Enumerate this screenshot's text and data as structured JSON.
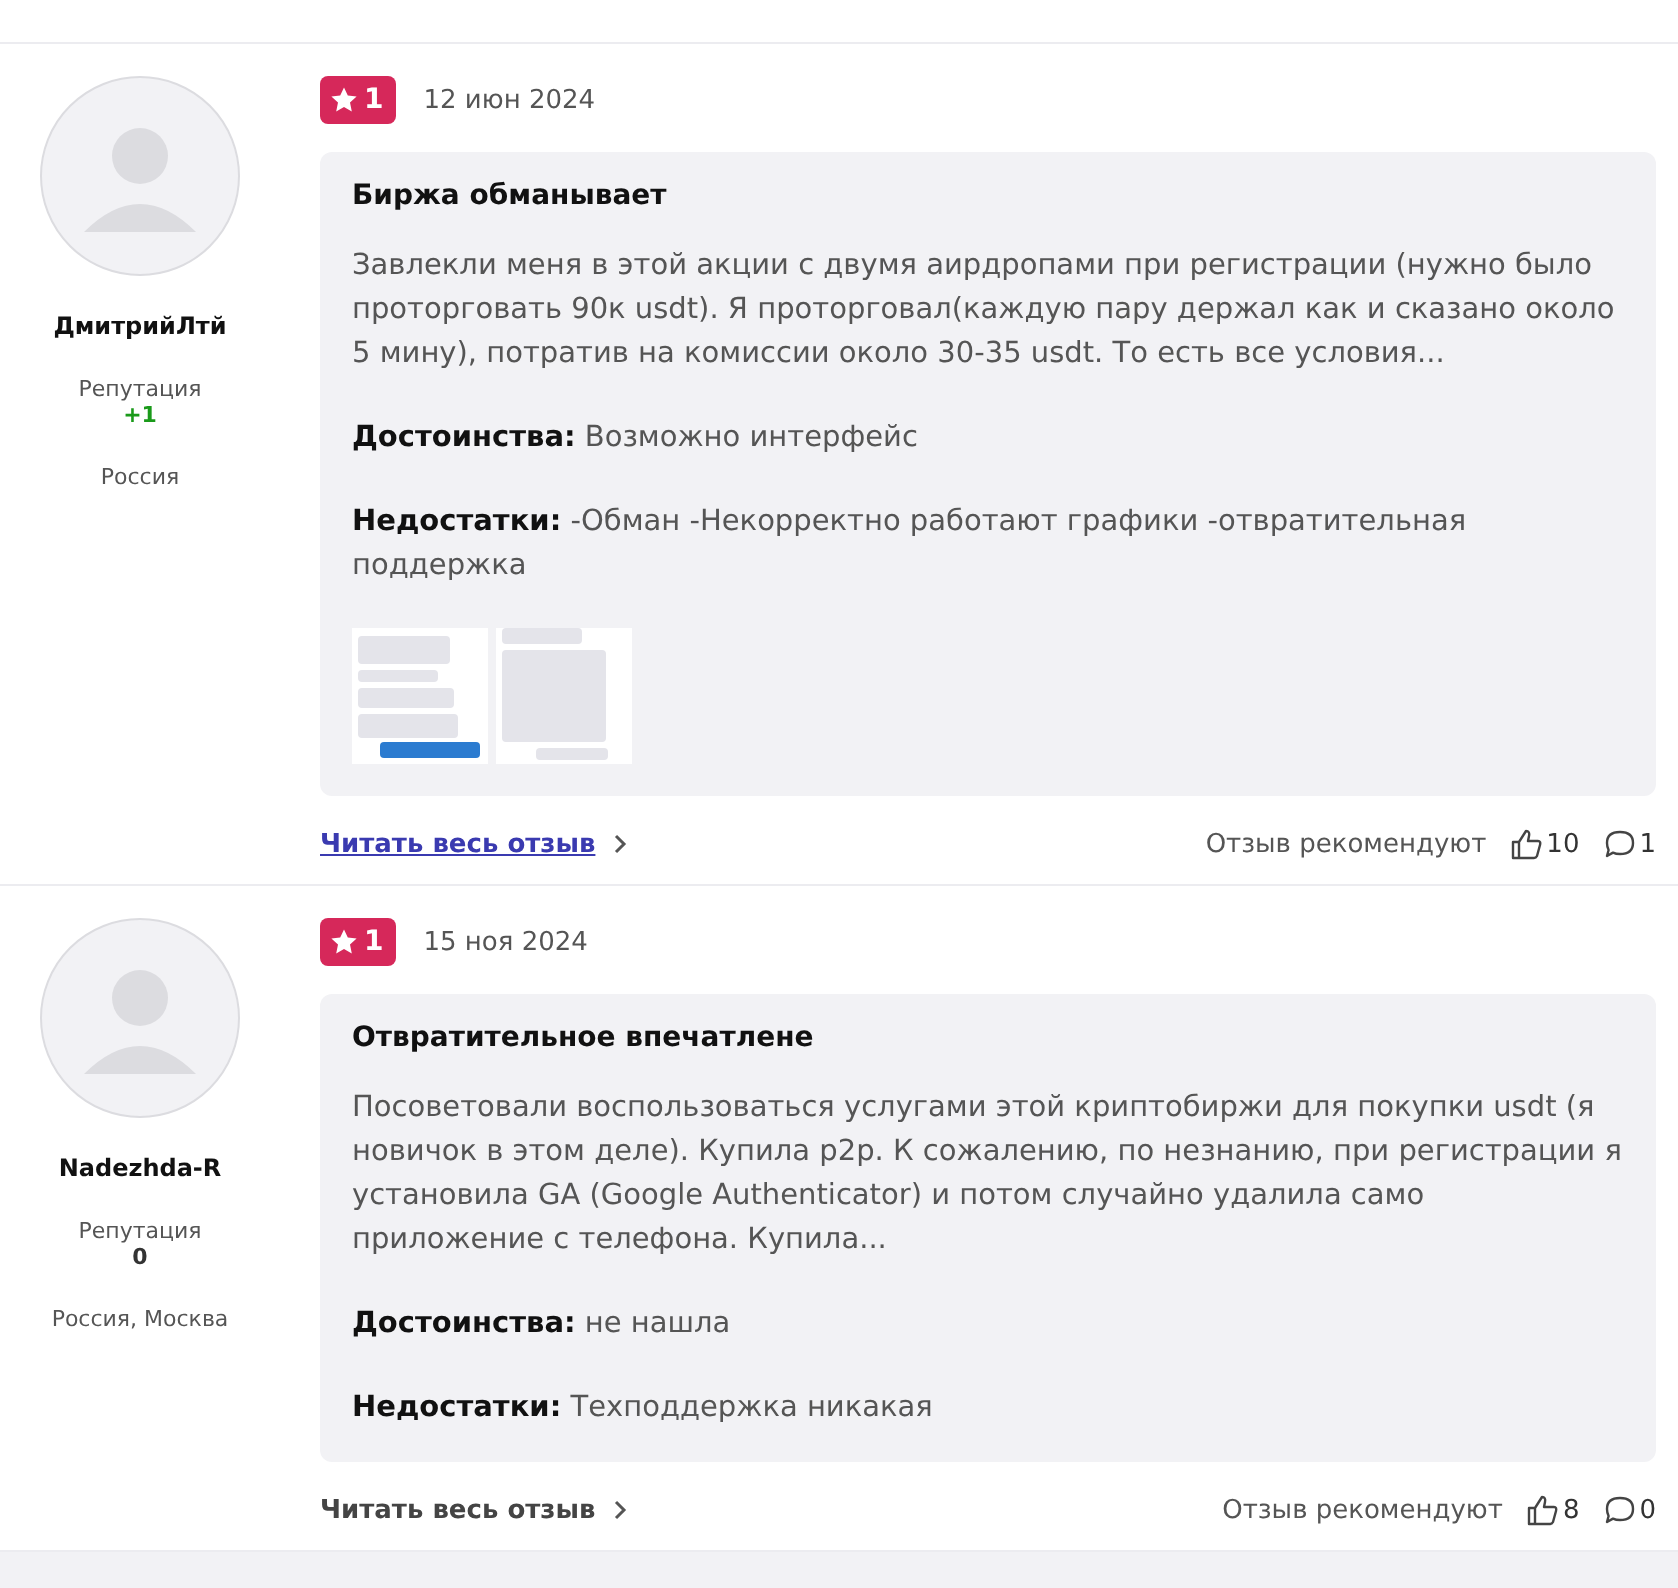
{
  "reviews": [
    {
      "author": "ДмитрийЛтй",
      "reputation_label": "Репутация",
      "reputation": {
        "value": "+1",
        "color": "#1a9a1a"
      },
      "location": "Россия",
      "rating": "1",
      "date": "12 июн 2024",
      "title": "Биржа обманывает",
      "text": "Завлекли меня в этой акции с двумя аирдропами при регистрации (нужно было проторговать 90к usdt). Я проторговал(каждую пару держал как и сказано около 5 мину), потратив на комиссии около 30-35 usdt. То есть все условия...",
      "pros_label": "Достоинства:",
      "pros": "Возможно интерфейс",
      "cons_label": "Недостатки:",
      "cons": "-Обман -Некорректно работают графики -отвратительная поддержка",
      "read_more": "Читать весь отзыв",
      "read_more_highlighted": true,
      "recommend_label": "Отзыв рекомендуют",
      "likes": "10",
      "comments": "1"
    },
    {
      "author": "Nadezhda-R",
      "reputation_label": "Репутация",
      "reputation": {
        "value": "0",
        "color": "#333333"
      },
      "location": "Россия, Москва",
      "rating": "1",
      "date": "15 ноя 2024",
      "title": "Отвратительное впечатлене",
      "text": "Посоветовали воспользоваться услугами этой криптобиржи для покупки usdt (я новичок в этом деле). Купила p2p. К сожалению, по незнанию, при регистрации я установила GA (Google Authenticator) и потом случайно удалила само приложение с телефона. Купила...",
      "pros_label": "Достоинства:",
      "pros": "не нашла",
      "cons_label": "Недостатки:",
      "cons": "Техподдержка никакая",
      "read_more": "Читать весь отзыв",
      "read_more_highlighted": false,
      "recommend_label": "Отзыв рекомендуют",
      "likes": "8",
      "comments": "0"
    }
  ]
}
